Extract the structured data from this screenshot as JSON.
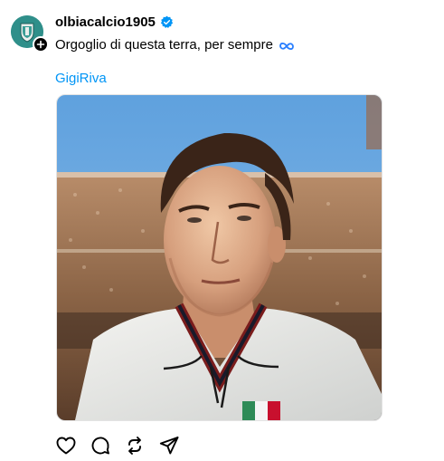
{
  "post": {
    "username": "olbiacalcio1905",
    "verified": true,
    "caption_text": "Orgoglio di questa terra, per sempre",
    "caption_emoji": "infinity-icon",
    "hashtag": "GigiRiva"
  },
  "icons": {
    "avatar": "club-crest-avatar",
    "follow": "plus-icon",
    "verified": "verified-badge-icon",
    "like": "heart-icon",
    "comment": "comment-icon",
    "repost": "repost-icon",
    "share": "share-icon"
  },
  "colors": {
    "link": "#0095f6",
    "verified": "#0095f6",
    "avatar_bg": "#2f8f8a"
  }
}
